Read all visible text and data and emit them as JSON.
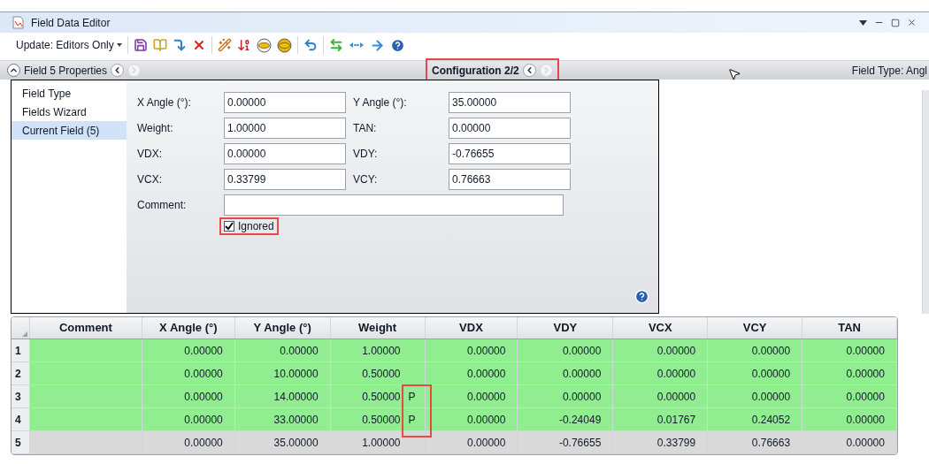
{
  "window": {
    "title": "Field Data Editor"
  },
  "toolbar": {
    "update_menu": "Update: Editors Only"
  },
  "properties_bar": {
    "title": "Field 5 Properties",
    "expanded": true,
    "prev_disabled": false,
    "next_disabled": true,
    "configuration": "Configuration 2/2",
    "configuration_highlighted": true,
    "config_prev_disabled": false,
    "config_next_disabled": true,
    "field_type": "Field Type: Angl"
  },
  "nav": [
    {
      "label": "Field Type",
      "selected": false
    },
    {
      "label": "Fields Wizard",
      "selected": false
    },
    {
      "label": "Current Field (5)",
      "selected": true
    }
  ],
  "form": {
    "fields": [
      {
        "label": "X Angle (°):",
        "value": "0.00000"
      },
      {
        "label": "Y Angle (°):",
        "value": "35.00000"
      },
      {
        "label": "Weight:",
        "value": "1.00000"
      },
      {
        "label": "TAN:",
        "value": "0.00000"
      },
      {
        "label": "VDX:",
        "value": "0.00000"
      },
      {
        "label": "VDY:",
        "value": "-0.76655"
      },
      {
        "label": "VCX:",
        "value": "0.33799"
      },
      {
        "label": "VCY:",
        "value": "0.76663"
      }
    ],
    "comment_label": "Comment:",
    "ignored": {
      "label": "Ignored",
      "checked": true,
      "highlighted": true
    }
  },
  "table": {
    "columns": [
      "Comment",
      "X Angle (°)",
      "Y Angle (°)",
      "Weight",
      "VDX",
      "VDY",
      "VCX",
      "VCY",
      "TAN"
    ],
    "solve_highlighted": true,
    "rows": [
      {
        "number": "1",
        "ignored": false,
        "x_angle": "0.00000",
        "y_angle": "0.00000",
        "weight": "1.00000",
        "vdx": "0.00000",
        "vdy": "0.00000",
        "vcx": "0.00000",
        "vcy": "0.00000",
        "tan": "0.00000"
      },
      {
        "number": "2",
        "ignored": false,
        "x_angle": "0.00000",
        "y_angle": "10.00000",
        "weight": "0.50000",
        "vdx": "0.00000",
        "vdy": "0.00000",
        "vcx": "0.00000",
        "vcy": "0.00000",
        "tan": "0.00000"
      },
      {
        "number": "3",
        "ignored": false,
        "x_angle": "0.00000",
        "y_angle": "14.00000",
        "weight": "0.50000",
        "solve": "P",
        "vdx": "0.00000",
        "vdy": "0.00000",
        "vcx": "0.00000",
        "vcy": "0.00000",
        "tan": "0.00000"
      },
      {
        "number": "4",
        "ignored": false,
        "x_angle": "0.00000",
        "y_angle": "33.00000",
        "weight": "0.50000",
        "solve": "P",
        "vdx": "0.00000",
        "vdy": "-0.24049",
        "vcx": "0.01767",
        "vcy": "0.24052",
        "tan": "0.00000"
      },
      {
        "number": "5",
        "ignored": true,
        "x_angle": "0.00000",
        "y_angle": "35.00000",
        "weight": "1.00000",
        "vdx": "0.00000",
        "vdy": "-0.76655",
        "vcx": "0.33799",
        "vcy": "0.76663",
        "tan": "0.00000"
      }
    ]
  }
}
